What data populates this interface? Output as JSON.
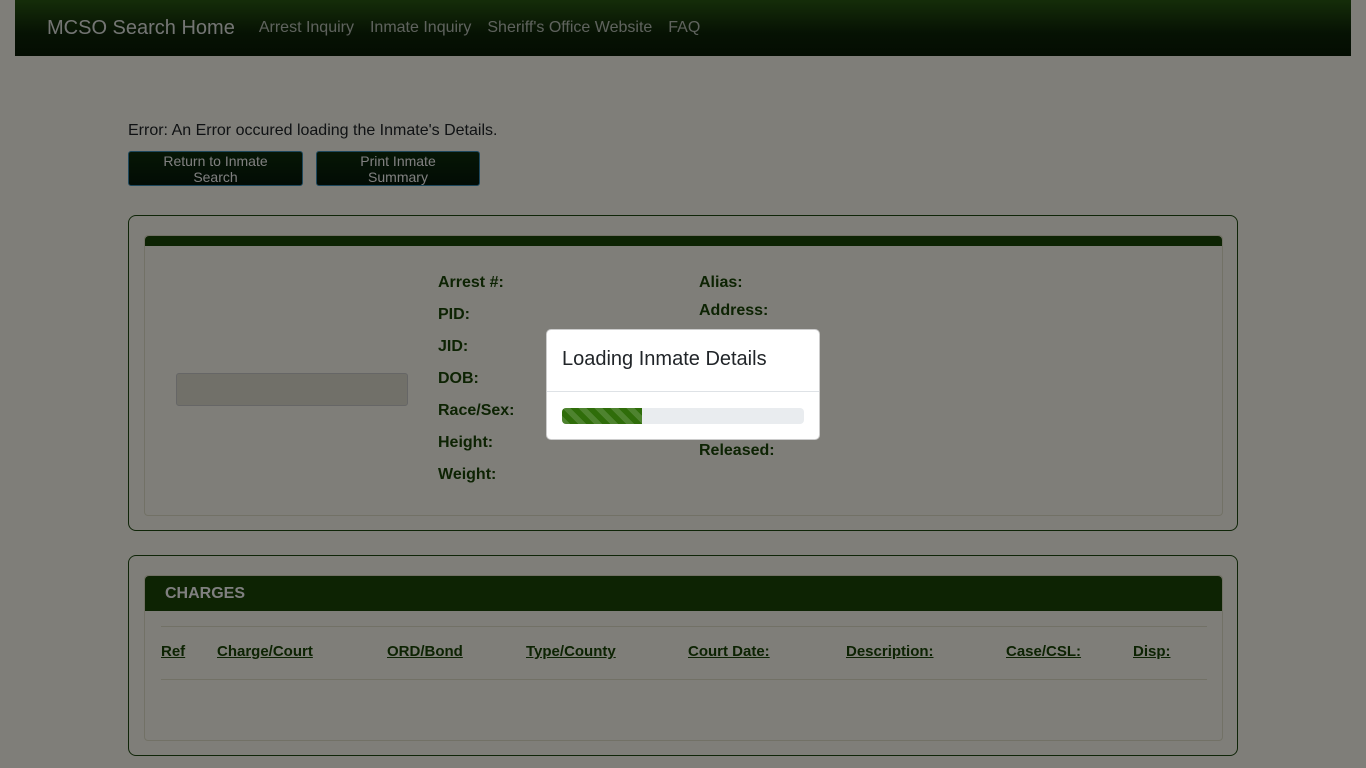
{
  "navbar": {
    "brand": "MCSO Search Home",
    "links": [
      "Arrest Inquiry",
      "Inmate Inquiry",
      "Sheriff's Office Website",
      "FAQ"
    ]
  },
  "error_message": "Error: An Error occured loading the Inmate's Details.",
  "buttons": {
    "return_label": "Return to Inmate Search",
    "print_label": "Print Inmate Summary"
  },
  "details": {
    "left_labels": [
      "Arrest #:",
      "PID:",
      "JID:",
      "DOB:",
      "Race/Sex:",
      "Height:",
      "Weight:"
    ],
    "right_labels": [
      "Alias:",
      "Address:",
      "Released:"
    ]
  },
  "charges": {
    "title": "CHARGES",
    "columns": [
      "Ref",
      "Charge/Court",
      "ORD/Bond",
      "Type/County",
      "Court Date:",
      "Description:",
      "Case/CSL:",
      "Disp:"
    ]
  },
  "modal": {
    "title": "Loading Inmate Details",
    "progress_fraction": 0.33
  },
  "colors": {
    "nav_dark": "#0d2407",
    "accent_green": "#1a4706",
    "progress_green": "#2f6d0a"
  }
}
